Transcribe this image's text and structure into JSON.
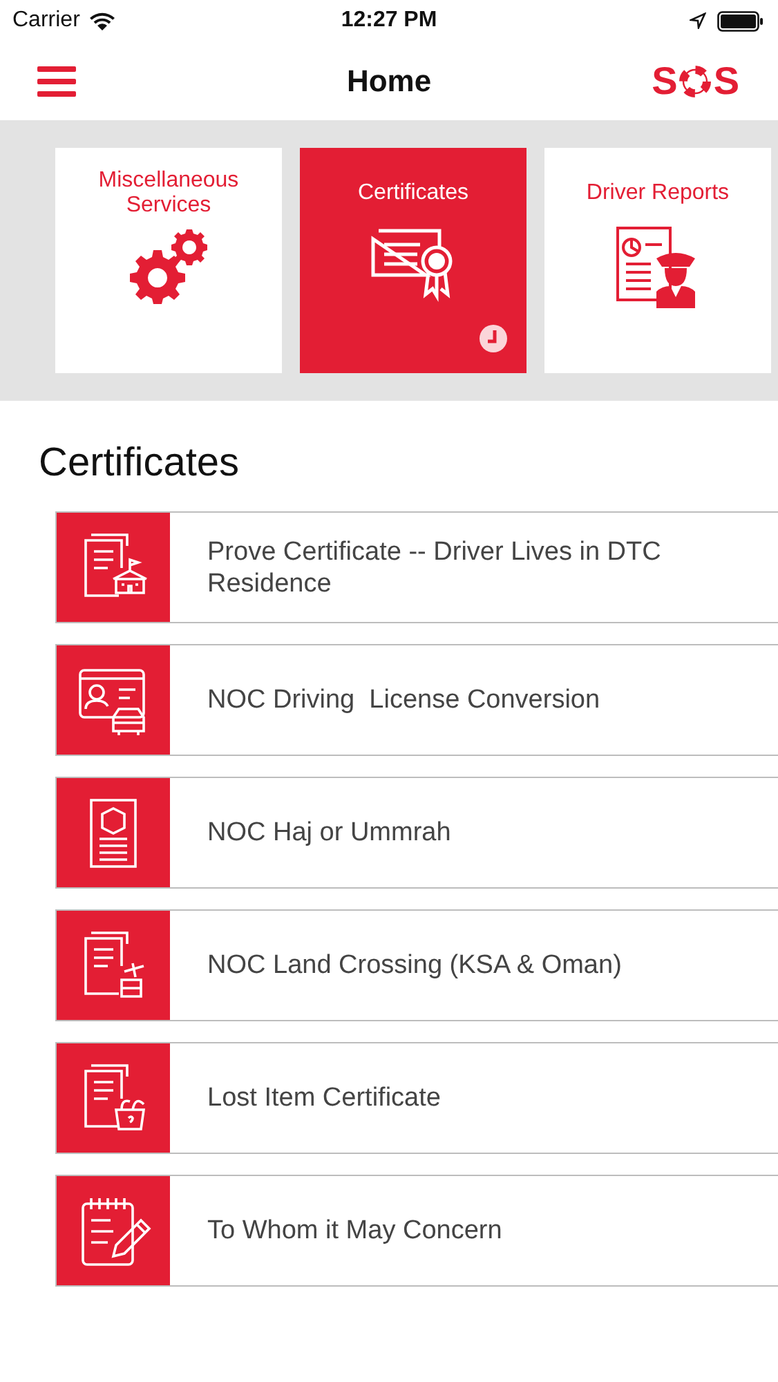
{
  "status_bar": {
    "carrier": "Carrier",
    "time": "12:27 PM"
  },
  "nav": {
    "title": "Home",
    "logo_left": "S",
    "logo_right": "S"
  },
  "tiles": [
    {
      "label": "Miscellaneous Services",
      "kind": "gears",
      "selected": false
    },
    {
      "label": "Certificates",
      "kind": "certificate",
      "selected": true
    },
    {
      "label": "Driver Reports",
      "kind": "report",
      "selected": false
    }
  ],
  "section_title": "Certificates",
  "items": [
    {
      "label": "Prove Certificate -- Driver Lives in DTC Residence",
      "kind": "residence"
    },
    {
      "label": "NOC Driving  License Conversion",
      "kind": "license"
    },
    {
      "label": "NOC Haj or Ummrah",
      "kind": "haj"
    },
    {
      "label": "NOC Land Crossing (KSA & Oman)",
      "kind": "crossing"
    },
    {
      "label": "Lost Item Certificate",
      "kind": "lost"
    },
    {
      "label": "To Whom it May Concern",
      "kind": "notepad"
    }
  ]
}
